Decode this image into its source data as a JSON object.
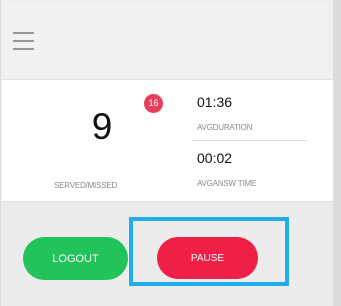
{
  "header": {
    "menu_icon": "hamburger-menu-icon"
  },
  "stats": {
    "served_count": "9",
    "missed_count": "16",
    "served_missed_label": "SERVED/MISSED",
    "avg_duration_value": "01:36",
    "avg_duration_label": "AVGDURATION",
    "avg_answer_value": "00:02",
    "avg_answer_label": "AVGANSW TIME"
  },
  "actions": {
    "logout_label": "LOGOUT",
    "pause_label": "PAUSE"
  },
  "colors": {
    "logout": "#22c35a",
    "pause": "#ef1f48",
    "badge": "#ea3d5b",
    "highlight": "#20aeea"
  }
}
